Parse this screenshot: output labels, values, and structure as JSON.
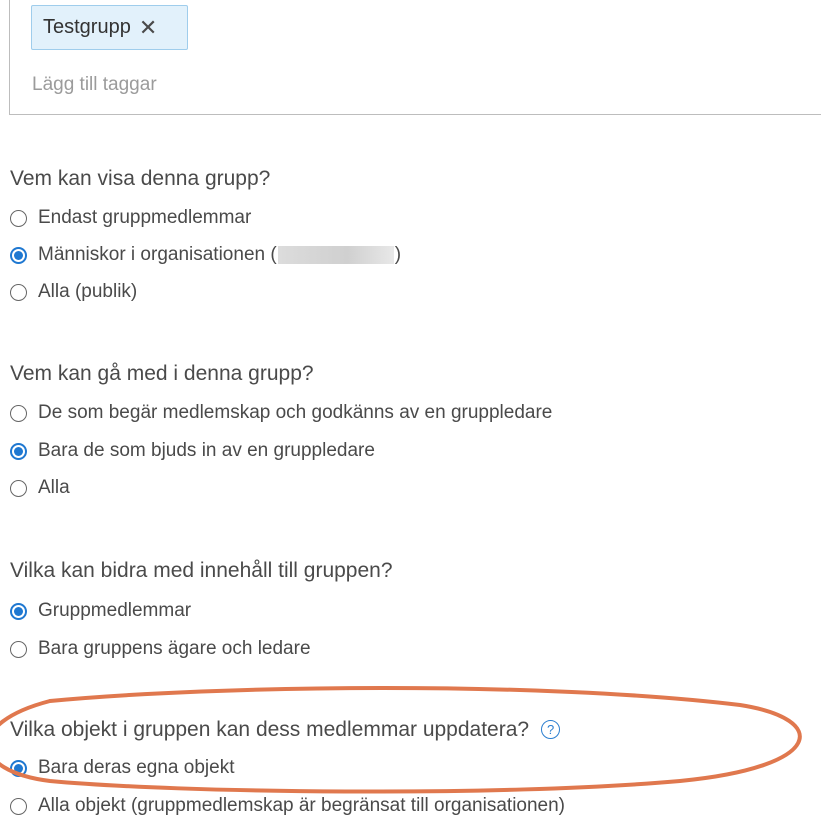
{
  "tags": {
    "chips": [
      {
        "label": "Testgrupp",
        "remove_glyph": "✕"
      }
    ],
    "input_placeholder": "Lägg till taggar"
  },
  "view": {
    "question": "Vem kan visa denna grupp?",
    "options": [
      {
        "label": "Endast gruppmedlemmar",
        "checked": false
      },
      {
        "label_prefix": "Människor i organisationen (",
        "label_suffix": ")",
        "checked": true
      },
      {
        "label": "Alla (publik)",
        "checked": false
      }
    ]
  },
  "join": {
    "question": "Vem kan gå med i denna grupp?",
    "options": [
      {
        "label": "De som begär medlemskap och godkänns av en gruppledare",
        "checked": false
      },
      {
        "label": "Bara de som bjuds in av en gruppledare",
        "checked": true
      },
      {
        "label": "Alla",
        "checked": false
      }
    ]
  },
  "contribute": {
    "question": "Vilka kan bidra med innehåll till gruppen?",
    "options": [
      {
        "label": "Gruppmedlemmar",
        "checked": true
      },
      {
        "label": "Bara gruppens ägare och ledare",
        "checked": false
      }
    ]
  },
  "update": {
    "question": "Vilka objekt i gruppen kan dess medlemmar uppdatera?",
    "help_glyph": "?",
    "options": [
      {
        "label": "Bara deras egna objekt",
        "checked": true
      },
      {
        "label": "Alla objekt (gruppmedlemskap är begränsat till organisationen)",
        "checked": false
      }
    ]
  },
  "colors": {
    "accent": "#1f78d1",
    "highlight": "#e0784e",
    "chip_bg": "#e2f1fb"
  }
}
